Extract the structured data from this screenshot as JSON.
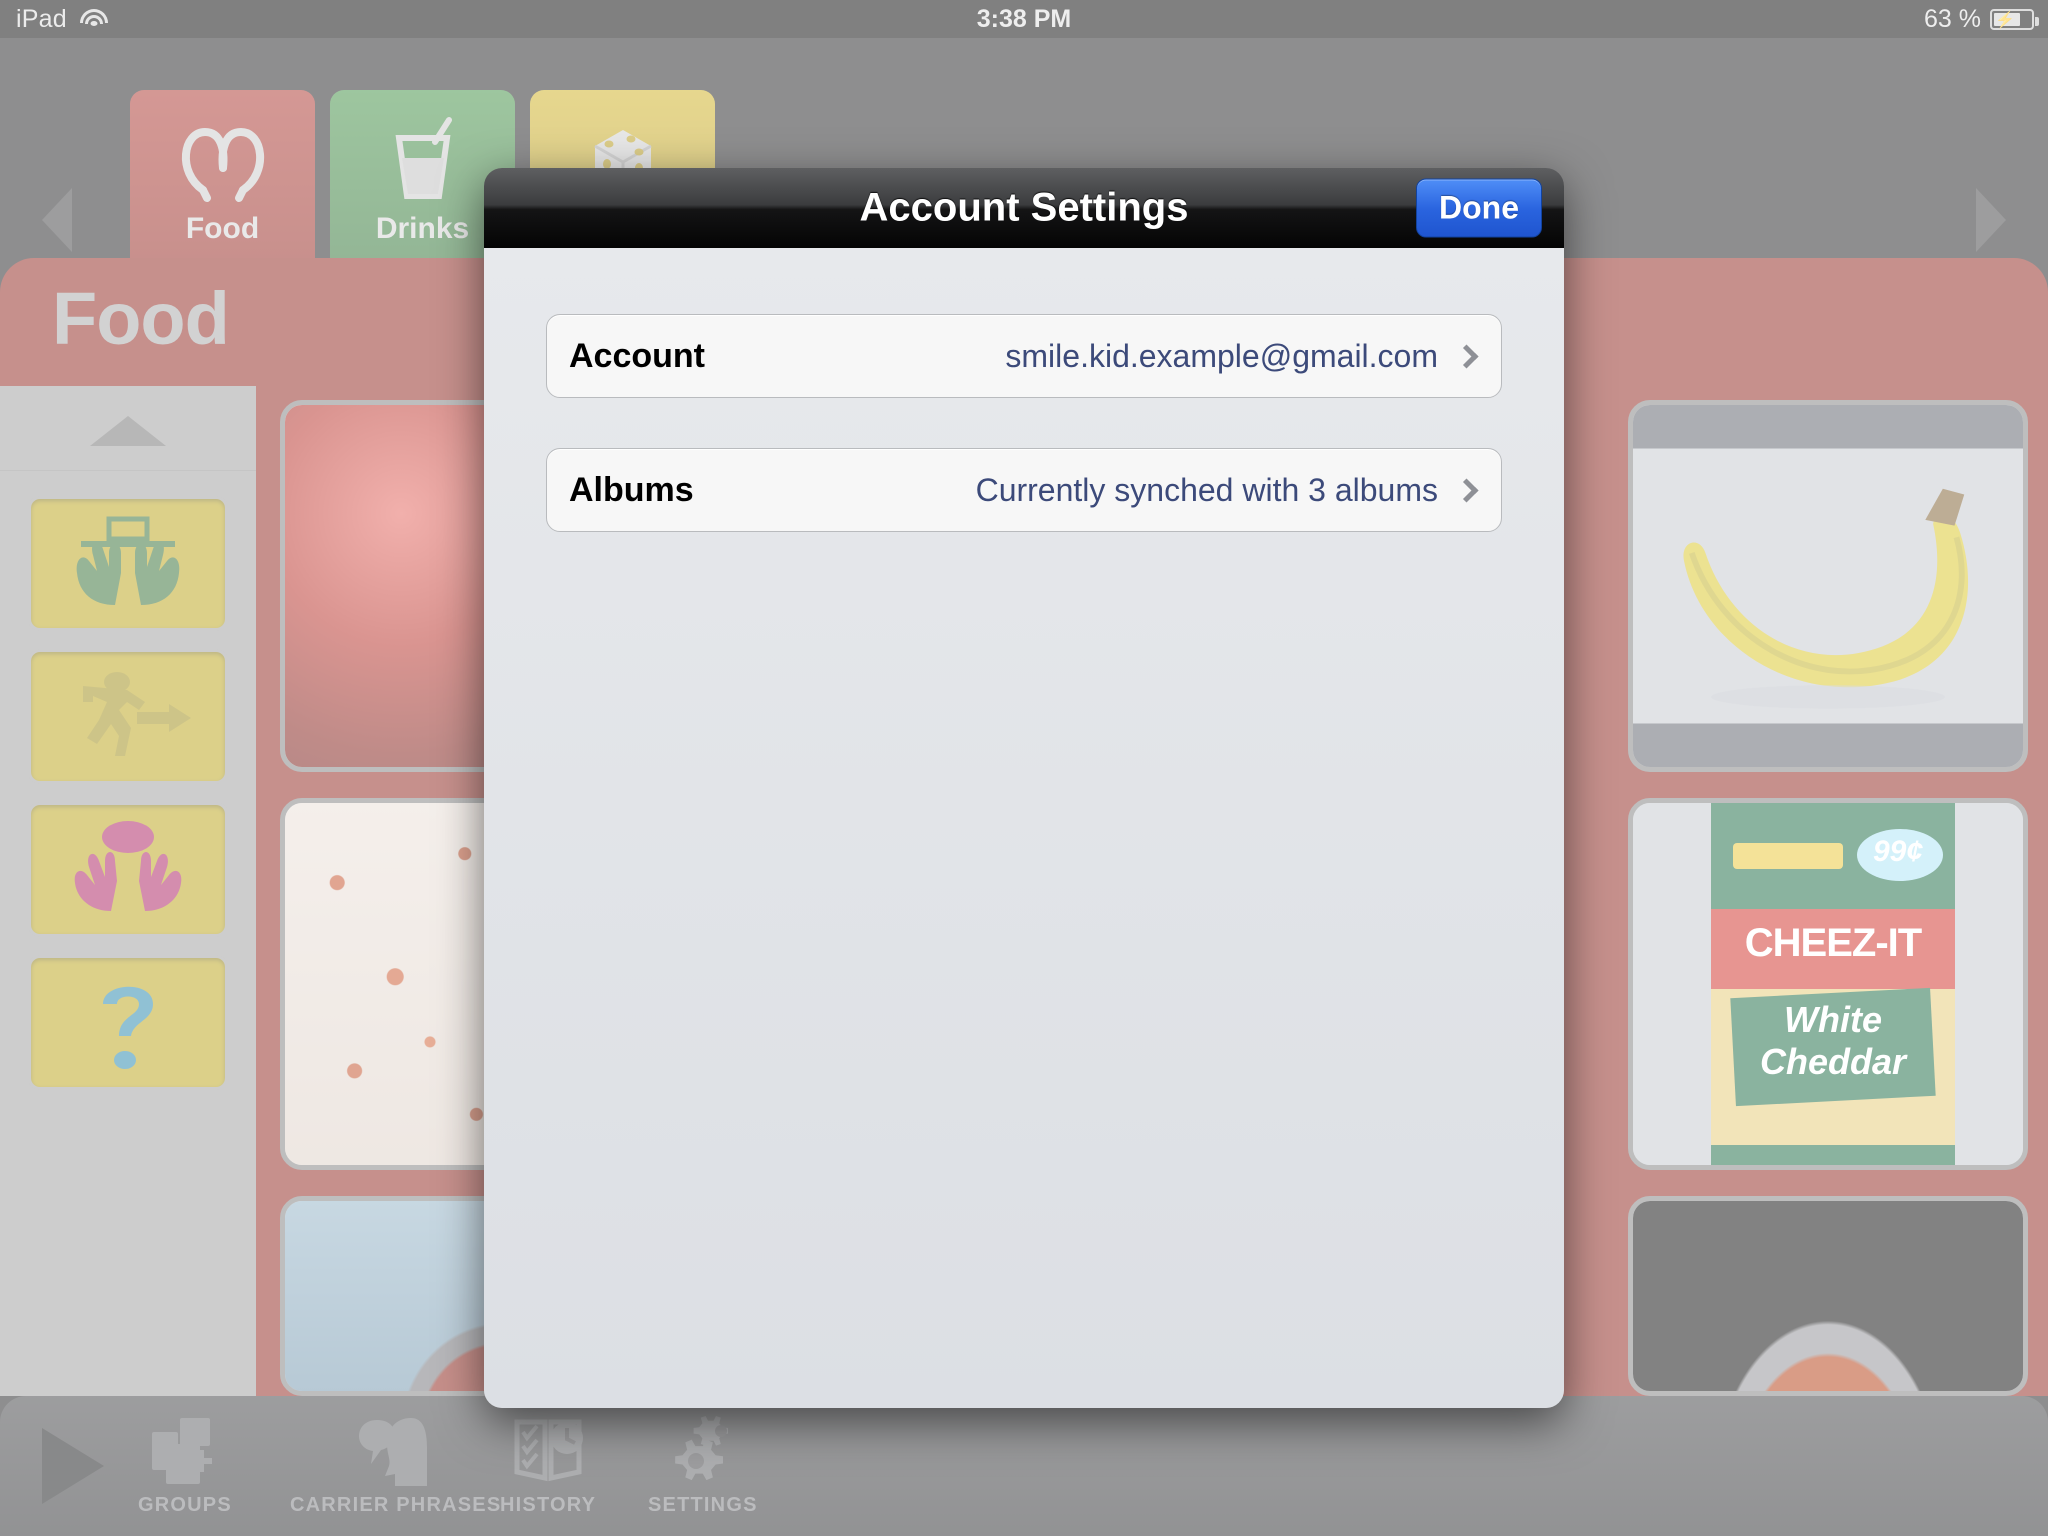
{
  "status_bar": {
    "device": "iPad",
    "wifi_icon": "wifi-icon",
    "time": "3:38 PM",
    "battery_percent": "63 %",
    "battery_icon": "battery-charging-icon"
  },
  "nav": {
    "prev_icon": "chevron-left-icon",
    "next_icon": "chevron-right-icon"
  },
  "tabs": [
    {
      "label": "Food",
      "icon": "pretzel-icon",
      "color": "#a42a22",
      "active": true
    },
    {
      "label": "Drinks",
      "icon": "drink-glass-icon",
      "color": "#2f7d32",
      "active": false
    },
    {
      "label": "",
      "icon": "dice-icon",
      "color": "#bfa21b",
      "active": false
    }
  ],
  "page": {
    "title": "Food",
    "band_color": "#8c2019"
  },
  "sidebar": {
    "collapse_icon": "caret-up-icon",
    "tiles": [
      {
        "icon": "hands-under-shelf-icon",
        "icon_color": "#2f6b2f"
      },
      {
        "icon": "running-person-exit-icon",
        "icon_color": "#9b8910"
      },
      {
        "icon": "hands-with-ball-icon",
        "icon_color": "#a81b5d"
      },
      {
        "icon": "question-mark-icon",
        "icon_color": "#2083a8"
      }
    ]
  },
  "grid": [
    {
      "name": "apple-tile",
      "subject": "red apple"
    },
    {
      "name": "banana-tile",
      "subject": "banana"
    },
    {
      "name": "crumbs-tile",
      "subject": "red and white speckled food"
    },
    {
      "name": "cheezit-tile",
      "subject": "Cheez-It White Cheddar box",
      "pack_price": "99¢",
      "pack_brand": "CHEEZ-IT",
      "pack_flavor_line1": "White",
      "pack_flavor_line2": "Cheddar"
    },
    {
      "name": "plate-tile",
      "subject": "plate on blue background"
    },
    {
      "name": "saucepan-tile",
      "subject": "pot of sauce"
    }
  ],
  "toolbar": {
    "play_icon": "play-icon",
    "items": [
      {
        "label": "GROUPS",
        "icon": "groups-add-icon"
      },
      {
        "label": "CARRIER PHRASES",
        "icon": "speech-heads-icon"
      },
      {
        "label": "HISTORY",
        "icon": "history-book-clock-icon"
      },
      {
        "label": "SETTINGS",
        "icon": "gears-icon"
      }
    ]
  },
  "modal": {
    "title": "Account Settings",
    "done_label": "Done",
    "rows": [
      {
        "label": "Account",
        "value": "smile.kid.example@gmail.com",
        "chevron": "chevron-right-icon"
      },
      {
        "label": "Albums",
        "value": "Currently synched with 3 albums",
        "chevron": "chevron-right-icon"
      }
    ]
  },
  "colors": {
    "accent_blue": "#2a64df",
    "brand_red": "#8c2019",
    "value_text": "#3c4a7a"
  }
}
